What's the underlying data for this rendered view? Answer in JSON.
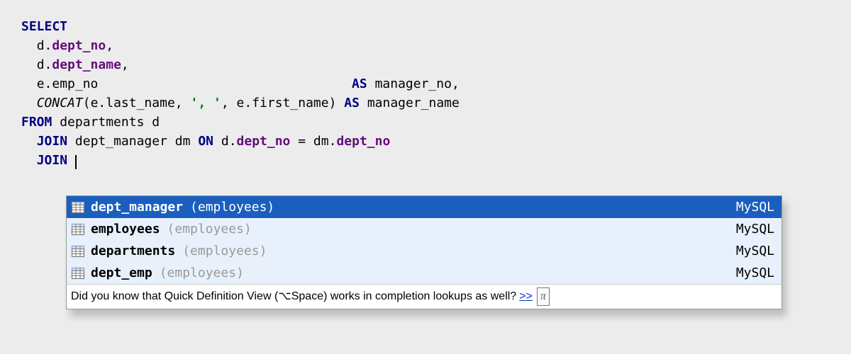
{
  "code": {
    "select": "SELECT",
    "d": "d",
    "dept_no": "dept_no",
    "dept_name": "dept_name",
    "e": "e",
    "emp_no": "emp_no",
    "as": "AS",
    "manager_no": "manager_no",
    "concat": "CONCAT",
    "last_name": "last_name",
    "first_name": "first_name",
    "str1": "', '",
    "manager_name": "manager_name",
    "from": "FROM",
    "departments": "departments",
    "alias_d": "d",
    "join": "JOIN",
    "dept_manager": "dept_manager",
    "alias_dm": "dm",
    "on": "ON",
    "dm": "dm",
    "eq": "="
  },
  "completion": {
    "items": [
      {
        "label": "dept_manager",
        "schema": "(employees)",
        "source": "MySQL",
        "selected": true
      },
      {
        "label": "employees",
        "schema": "(employees)",
        "source": "MySQL",
        "selected": false
      },
      {
        "label": "departments",
        "schema": "(employees)",
        "source": "MySQL",
        "selected": false
      },
      {
        "label": "dept_emp",
        "schema": "(employees)",
        "source": "MySQL",
        "selected": false
      }
    ],
    "hint_prefix": "Did you know that Quick Definition View (⌥Space) works in completion lookups as well?",
    "hint_link": ">>",
    "hint_pi": "π"
  }
}
